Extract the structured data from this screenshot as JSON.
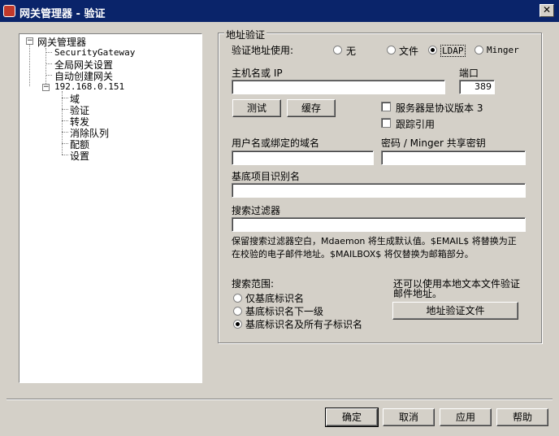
{
  "window": {
    "title": "网关管理器 - 验证",
    "close_label": "✕"
  },
  "tree": {
    "root": "网关管理器",
    "items": [
      "SecurityGateway",
      "全局网关设置",
      "自动创建网关"
    ],
    "ip_node": "192.168.0.151",
    "ip_children": [
      "域",
      "验证",
      "转发",
      "消除队列",
      "配额",
      "设置"
    ]
  },
  "form": {
    "group_title": "地址验证",
    "verify_label": "验证地址使用:",
    "radios": [
      "无",
      "文件",
      "LDAP",
      "Minger"
    ],
    "selected_method": "LDAP",
    "host_label": "主机名或 IP",
    "host_value": "",
    "port_label": "端口",
    "port_value": "389",
    "test_button": "测试",
    "cache_button": "缓存",
    "check_protocol3": "服务器是协议版本 3",
    "check_referral": "跟踪引用",
    "user_label": "用户名或绑定的域名",
    "user_value": "",
    "password_label": "密码 / Minger 共享密钥",
    "password_value": "",
    "base_label": "基底项目识别名",
    "base_value": "",
    "filter_label": "搜索过滤器",
    "filter_value": "",
    "help_line1": "保留搜索过滤器空白，Mdaemon 将生成默认值。$EMAIL$ 将替换为正",
    "help_line2": "在校验的电子邮件地址。$MAILBOX$ 将仅替换为邮箱部分。",
    "scope_label": "搜索范围:",
    "scope_options": [
      "仅基底标识名",
      "基底标识名下一级",
      "基底标识名及所有子标识名"
    ],
    "selected_scope": "基底标识名及所有子标识名",
    "text_file_note_1": "还可以使用本地文本文件验证",
    "text_file_note_2": "邮件地址。",
    "text_file_button": "地址验证文件"
  },
  "buttons": {
    "ok": "确定",
    "cancel": "取消",
    "apply": "应用",
    "help": "帮助"
  }
}
